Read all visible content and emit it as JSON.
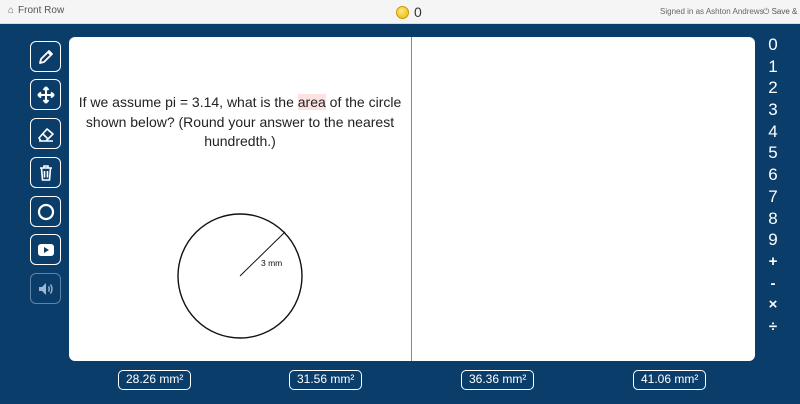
{
  "topbar": {
    "brand": "Front Row",
    "coins": "0",
    "signed_in": "Signed in as Ashton Andrews",
    "save": "Save & C"
  },
  "tools": [
    {
      "name": "pencil-icon"
    },
    {
      "name": "move-icon"
    },
    {
      "name": "eraser-icon"
    },
    {
      "name": "trash-icon"
    },
    {
      "name": "circle-icon"
    },
    {
      "name": "play-icon"
    },
    {
      "name": "speaker-icon"
    }
  ],
  "question": {
    "before": "If we assume pi = 3.14, what is the ",
    "highlight": "area",
    "after": " of the circle shown below? (Round your answer to the nearest hundredth.)"
  },
  "figure": {
    "radius_label": "3 mm"
  },
  "keypad": [
    "0",
    "1",
    "2",
    "3",
    "4",
    "5",
    "6",
    "7",
    "8",
    "9",
    "+",
    "-",
    "×",
    "÷"
  ],
  "answers": [
    "28.26 mm²",
    "31.56 mm²",
    "36.36 mm²",
    "41.06 mm²"
  ],
  "colors": {
    "background": "#0b3d6b",
    "highlight": "#fde2e2"
  }
}
